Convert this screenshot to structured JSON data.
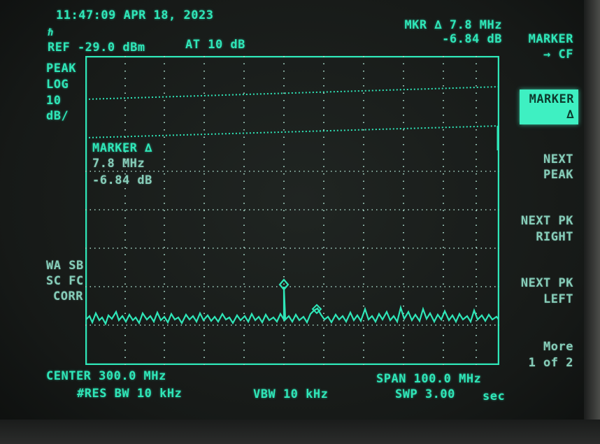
{
  "header": {
    "timestamp": "11:47:09 APR 18, 2023",
    "ref_level": "REF -29.0 dBm",
    "attenuation": "AT 10 dB",
    "marker_readout_freq": "MKR ∆ 7.8 MHz",
    "marker_readout_ampl": "-6.84 dB"
  },
  "left_labels": {
    "detector": "PEAK",
    "scale_type": "LOG",
    "scale_value": "10",
    "scale_unit": "dB/",
    "wa_sb": "WA SB",
    "sc_fc": "SC FC",
    "corr": "CORR"
  },
  "in_graph_marker": {
    "title": "MARKER ∆",
    "freq": "7.8 MHz",
    "ampl": "-6.84 dB"
  },
  "footer": {
    "center": "CENTER 300.0 MHz",
    "span": "SPAN 100.0 MHz",
    "res_bw": "#RES BW 10 kHz",
    "vbw": "VBW 10 kHz",
    "sweep": "SWP 3.00",
    "sweep_unit": "sec"
  },
  "softkeys": {
    "marker_cf_1": "MARKER",
    "marker_cf_2": "→ CF",
    "marker_sel_1": "MARKER",
    "marker_sel_2": "∆",
    "next_peak_1": "NEXT",
    "next_peak_2": "PEAK",
    "next_pk_right_1": "NEXT PK",
    "next_pk_right_2": "RIGHT",
    "next_pk_left_1": "NEXT PK",
    "next_pk_left_2": "LEFT",
    "more_1": "More",
    "more_2": "1 of 2"
  },
  "colors": {
    "phosphor": "#2fe6b8",
    "phosphor_dim": "#86cdb9",
    "softkey_highlight": "#3ef0c2"
  }
}
